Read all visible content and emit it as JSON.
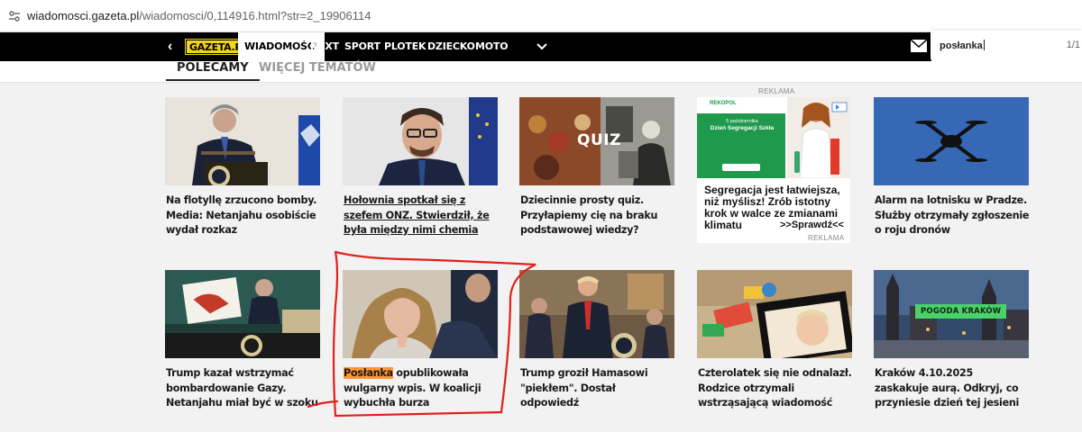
{
  "browser": {
    "url_host": "wiadomosci.gazeta.pl",
    "url_path": "/wiadomosci/0,114916.html?str=2_19906114"
  },
  "nav": {
    "logo": "GAZETA.PL",
    "items": [
      "WIADOMOŚCI",
      "NEXT",
      "SPORT",
      "PLOTEK",
      "DZIECKO",
      "MOTO"
    ],
    "active_index": 0
  },
  "find": {
    "query": "posłanka",
    "count": "1/1"
  },
  "tabs": [
    {
      "label": "POLECAMY",
      "active": true
    },
    {
      "label": "WIĘCEJ TEMATÓW",
      "active": false
    }
  ],
  "articles_row1": [
    {
      "title": "Na flotyllę zrzucono bomby. Media: Netanjahu osobiście wydał rozkaz",
      "underline": false
    },
    {
      "title": "Hołownia spotkał się z szefem ONZ. Stwierdził, że była między nimi chemia",
      "underline": true
    },
    {
      "title": "Dziecinnie prosty quiz. Przyłapiemy cię na braku podstawowej wiedzy?",
      "underline": false,
      "overlay": "QUIZ"
    },
    {
      "title": "Alarm na lotnisku w Pradze. Służby otrzymały zgłoszenie o roju dronów",
      "underline": false
    }
  ],
  "ad": {
    "label": "REKLAMA",
    "brand": "REKOPOL",
    "banner_line1": "5 października",
    "banner_line2": "Dzień Segregacji Szkła",
    "text": "Segregacja jest łatwiejsza, niż myślisz! Zrób istotny krok w walce ze zmianami klimatu",
    "cta": ">>Sprawdź<<"
  },
  "articles_row2": [
    {
      "title": "Trump kazał wstrzymać bombardowanie Gazy. Netanjahu miał być w szoku"
    },
    {
      "title_highlight": "Posłanka",
      "title_rest": " opublikowała wulgarny wpis. W koalicji wybuchła burza"
    },
    {
      "title": "Trump groził Hamasowi \"piekłem\". Dostał odpowiedź"
    },
    {
      "title": "Czterolatek się nie odnalazł. Rodzice otrzymali wstrząsającą wiadomość"
    },
    {
      "title": "Kraków 4.10.2025 zaskakuje aurą. Odkryj, co przyniesie dzień tej jesieni",
      "overlay": "POGODA KRAKÓW"
    }
  ],
  "colors": {
    "nav_bg": "#000000",
    "logo_bg": "#f0d419",
    "find_highlight": "#ff9632",
    "annotation": "#e0201a",
    "page_bg": "#f2f2f2"
  }
}
